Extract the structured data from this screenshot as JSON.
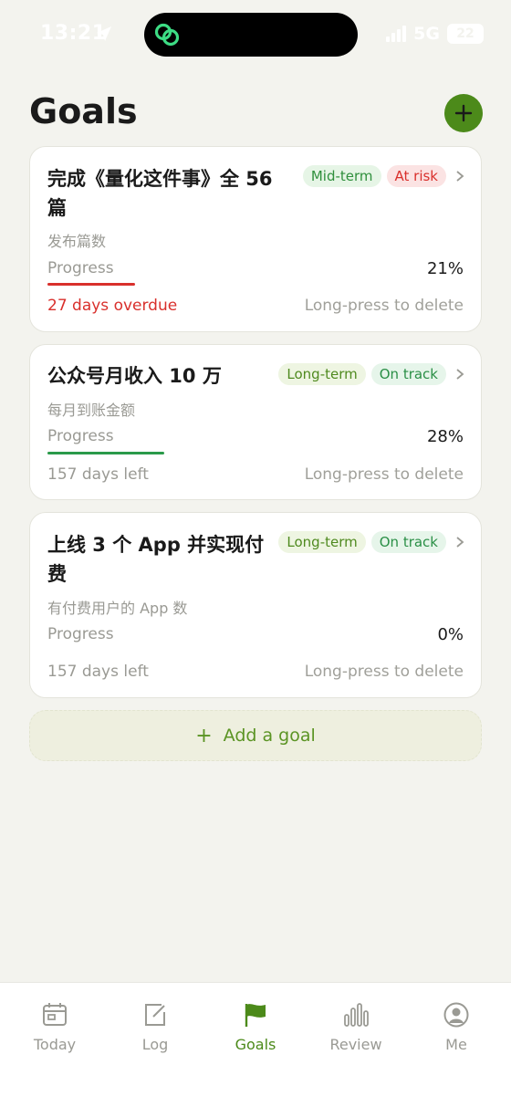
{
  "status_bar": {
    "time": "13:21",
    "network": "5G",
    "battery": "22"
  },
  "header": {
    "title": "Goals"
  },
  "goals": [
    {
      "title_line1": "完成《量化这件事》全 56",
      "title_line2": "篇",
      "subtitle": "发布篇数",
      "term": "Mid-term",
      "status": "At risk",
      "progress_label": "Progress",
      "progress_text": "21%",
      "progress": 0.21,
      "due_text": "27 days overdue",
      "delete_hint": "Long-press to delete"
    },
    {
      "title_line1": "公众号月收入 10 万",
      "title_line2": "",
      "subtitle": "每月到账金额",
      "term": "Long-term",
      "status": "On track",
      "progress_label": "Progress",
      "progress_text": "28%",
      "progress": 0.28,
      "due_text": "157 days left",
      "delete_hint": "Long-press to delete"
    },
    {
      "title_line1": "上线 3 个 App 并实现付",
      "title_line2": "费",
      "subtitle": "有付费用户的 App 数",
      "term": "Long-term",
      "status": "On track",
      "progress_label": "Progress",
      "progress_text": "0%",
      "progress": 0,
      "due_text": "157 days left",
      "delete_hint": "Long-press to delete"
    }
  ],
  "add_goal": {
    "plus": "+",
    "label": "Add a goal"
  },
  "tabbar": {
    "items": [
      {
        "label": "Today",
        "icon": "calendar-icon"
      },
      {
        "label": "Log",
        "icon": "edit-icon"
      },
      {
        "label": "Goals",
        "icon": "flag-icon",
        "active": true
      },
      {
        "label": "Review",
        "icon": "bar-chart-icon"
      },
      {
        "label": "Me",
        "icon": "user-icon"
      }
    ]
  },
  "colors": {
    "accent": "#4c8a1a",
    "risk": "#d9302c",
    "track": "#2a9a4a",
    "background": "#f3f3ee"
  }
}
